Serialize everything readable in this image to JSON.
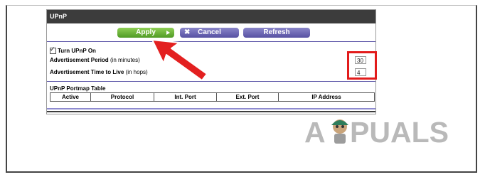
{
  "panel": {
    "title": "UPnP"
  },
  "toolbar": {
    "apply_label": "Apply",
    "cancel_label": "Cancel",
    "refresh_label": "Refresh",
    "cancel_icon": "x-icon",
    "apply_icon": "play-icon"
  },
  "settings": {
    "turn_on_label": "Turn UPnP On",
    "turn_on_checked": true,
    "adv_period_label": "Advertisement Period",
    "adv_period_unit": "(in minutes)",
    "adv_period_value": "30",
    "adv_ttl_label": "Advertisement Time to Live",
    "adv_ttl_unit": "(in hops)",
    "adv_ttl_value": "4"
  },
  "portmap": {
    "title": "UPnP Portmap Table",
    "columns": [
      "Active",
      "Protocol",
      "Int. Port",
      "Ext. Port",
      "IP Address"
    ]
  },
  "watermark": {
    "text": "APPUALS"
  },
  "colors": {
    "apply_green": "#5aa82e",
    "button_purple": "#6963b3",
    "titlebar": "#3c3c3c",
    "highlight_red": "#e21b1b"
  }
}
